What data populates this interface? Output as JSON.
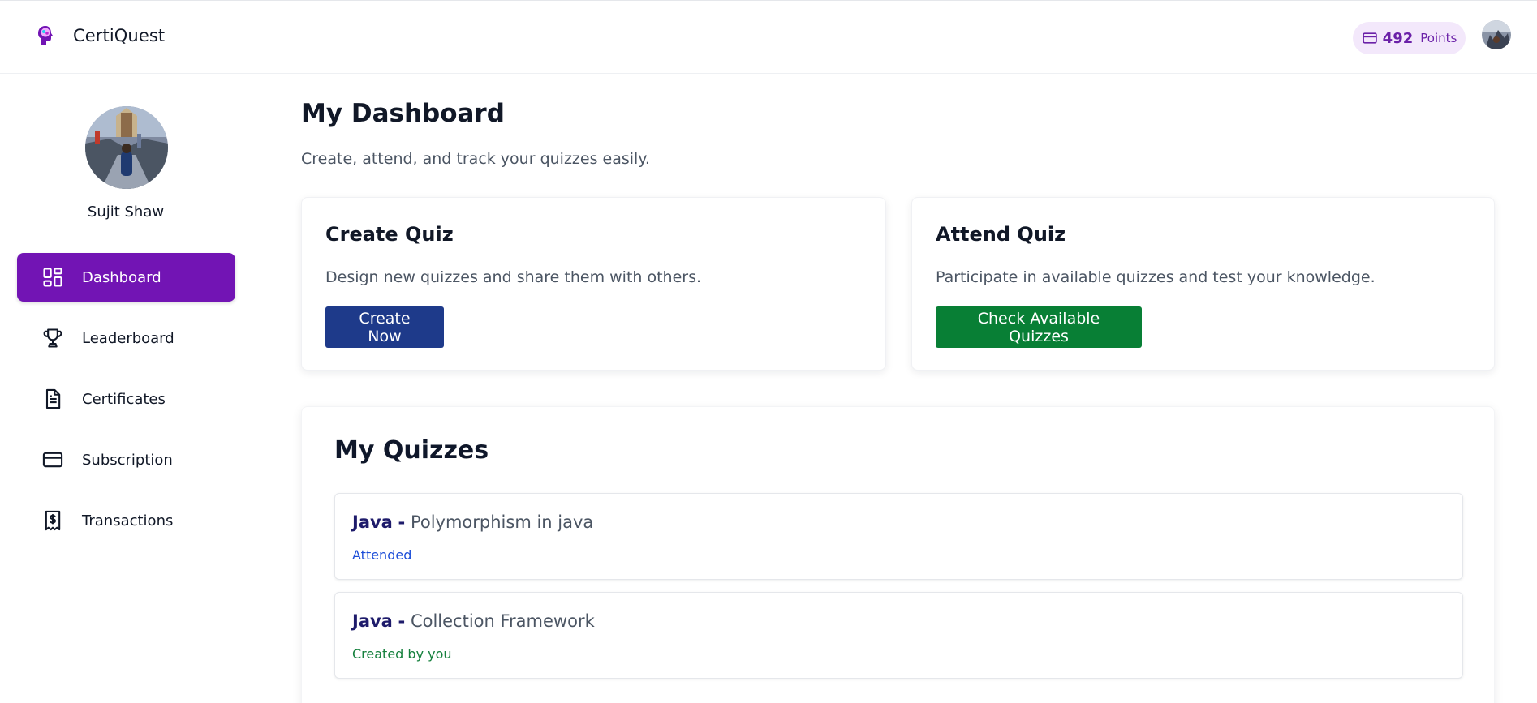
{
  "header": {
    "brand_name": "CertiQuest",
    "points_value": "492",
    "points_label": "Points"
  },
  "sidebar": {
    "user_name": "Sujit Shaw",
    "items": [
      {
        "label": "Dashboard",
        "icon": "dashboard-grid-icon",
        "active": true
      },
      {
        "label": "Leaderboard",
        "icon": "trophy-icon",
        "active": false
      },
      {
        "label": "Certificates",
        "icon": "document-icon",
        "active": false
      },
      {
        "label": "Subscription",
        "icon": "credit-card-icon",
        "active": false
      },
      {
        "label": "Transactions",
        "icon": "receipt-dollar-icon",
        "active": false
      }
    ]
  },
  "main": {
    "title": "My Dashboard",
    "subtitle": "Create, attend, and track your quizzes easily.",
    "create_card": {
      "title": "Create Quiz",
      "description": "Design new quizzes and share them with others.",
      "button": "Create Now"
    },
    "attend_card": {
      "title": "Attend Quiz",
      "description": "Participate in available quizzes and test your knowledge.",
      "button": "Check Available Quizzes"
    },
    "quizzes": {
      "title": "My Quizzes",
      "items": [
        {
          "category": "Java",
          "separator": "-",
          "name": "Polymorphism in java",
          "status": "Attended"
        },
        {
          "category": "Java",
          "separator": "-",
          "name": "Collection Framework",
          "status": "Created by you"
        }
      ]
    }
  },
  "colors": {
    "accent_purple": "#7214b4",
    "button_blue": "#1e3a8a",
    "button_green": "#087f35",
    "points_bg": "#f3e8fb"
  }
}
